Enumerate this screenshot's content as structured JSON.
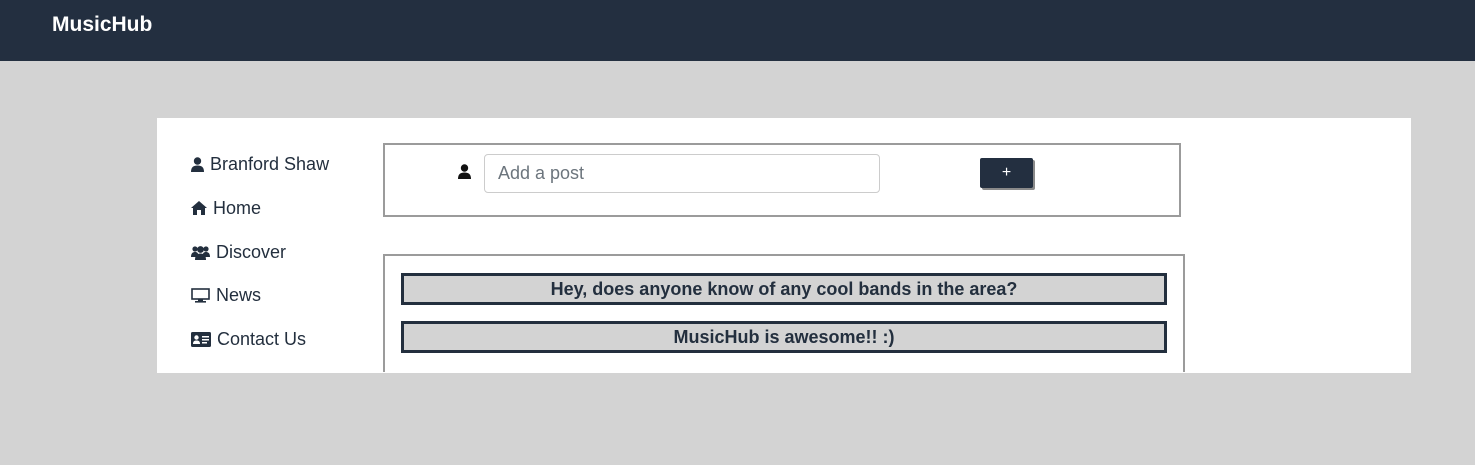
{
  "app": {
    "title": "MusicHub"
  },
  "sidebar": {
    "items": [
      {
        "label": "Branford Shaw",
        "icon": "user-icon"
      },
      {
        "label": "Home",
        "icon": "home-icon"
      },
      {
        "label": "Discover",
        "icon": "users-icon"
      },
      {
        "label": "News",
        "icon": "monitor-icon"
      },
      {
        "label": "Contact Us",
        "icon": "address-card-icon"
      }
    ]
  },
  "composer": {
    "placeholder": "Add a post",
    "value": "",
    "add_label": "+"
  },
  "feed": {
    "posts": [
      {
        "text": "Hey, does anyone know of any cool bands in the area?"
      },
      {
        "text": "MusicHub is awesome!! :)"
      }
    ]
  },
  "colors": {
    "navbar": "#232f40",
    "background": "#d3d3d3",
    "text": "#232f3e",
    "card": "#ffffff"
  }
}
